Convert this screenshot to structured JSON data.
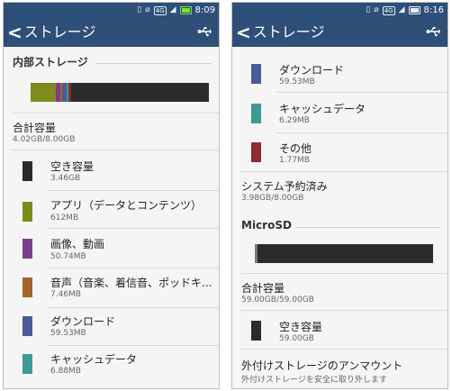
{
  "left": {
    "status": {
      "time": "8:09",
      "signal_badge": "4G"
    },
    "appbar": {
      "back_glyph": "<",
      "title": "ストレージ"
    },
    "internal": {
      "header": "内部ストレージ",
      "total_title": "合計容量",
      "total_value": "4.02GB/8.00GB",
      "items": [
        {
          "label": "空き容量",
          "size": "3.46GB",
          "color": "#2b2b2b"
        },
        {
          "label": "アプリ（データとコンテンツ）",
          "size": "612MB",
          "color": "#7d8c1c"
        },
        {
          "label": "画像、動画",
          "size": "50.74MB",
          "color": "#7e3b8a"
        },
        {
          "label": "音声（音楽、着信音、ポッドキ...",
          "size": "7.46MB",
          "color": "#a5642a"
        },
        {
          "label": "ダウンロード",
          "size": "59.53MB",
          "color": "#4a5b9a"
        },
        {
          "label": "キャッシュデータ",
          "size": "6.88MB",
          "color": "#3d9b93"
        }
      ]
    }
  },
  "right": {
    "status": {
      "time": "8:16",
      "signal_badge": "4G"
    },
    "appbar": {
      "back_glyph": "<",
      "title": "ストレージ"
    },
    "items_top": [
      {
        "label": "ダウンロード",
        "size": "59.53MB",
        "color": "#4a5b9a"
      },
      {
        "label": "キャッシュデータ",
        "size": "6.29MB",
        "color": "#3d9b93"
      },
      {
        "label": "その他",
        "size": "1.77MB",
        "color": "#8e2b2b"
      }
    ],
    "system": {
      "title": "システム予約済み",
      "value": "3.98GB/8.00GB"
    },
    "sd": {
      "header": "MicroSD",
      "total_title": "合計容量",
      "total_value": "59.00GB/59.00GB",
      "free": {
        "label": "空き容量",
        "size": "59.00GB",
        "color": "#2b2b2b"
      },
      "unmount": {
        "title": "外付けストレージのアンマウント",
        "subtitle": "外付けストレージを安全に取り外します"
      }
    }
  },
  "colors": {
    "appbar": "#2d4f78",
    "bar_empty": "#2b2b2b",
    "battery_charging": "#7fdc3a"
  }
}
